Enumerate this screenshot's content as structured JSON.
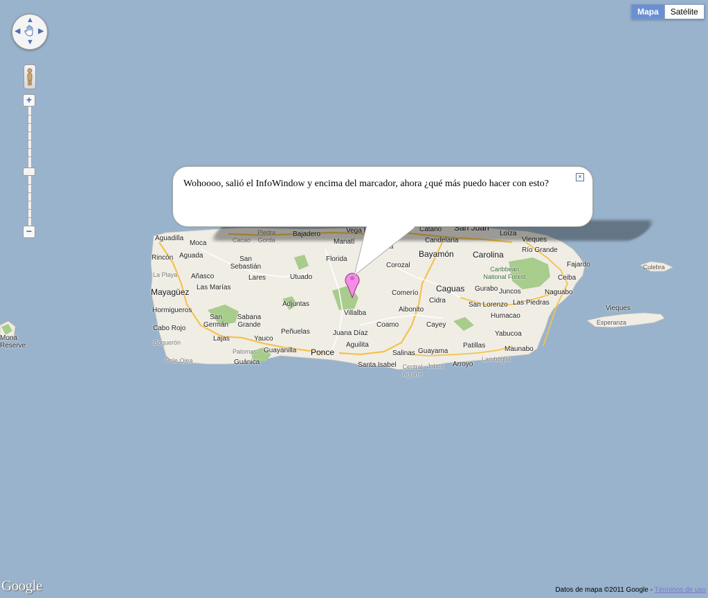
{
  "map_controls": {
    "map_type_buttons": [
      "Mapa",
      "Satélite"
    ],
    "active_map_type": "Mapa",
    "zoom_in": "+",
    "zoom_out": "−",
    "pan_arrows": [
      "▲",
      "◀",
      "▶",
      "▼"
    ]
  },
  "info_window": {
    "text": "Wohoooo, salió el InfoWindow y encima del marcador, ahora ¿qué más puedo hacer con esto?",
    "close": "×"
  },
  "marker": {
    "color": "#f58de6"
  },
  "place_labels": [
    "Aguadilla",
    "Moca",
    "Cacao",
    "Piedra Gorda",
    "Bajadero",
    "Vega Baja",
    "Manatí",
    "Vega Alta",
    "Cataño",
    "San Juan",
    "Loíza",
    "Vieques",
    "Candelaria",
    "Rincón",
    "Aguada",
    "San Sebastián",
    "Florida",
    "Corozal",
    "Bayamón",
    "Carolina",
    "Río Grande",
    "Fajardo",
    "Culebra",
    "La Playa",
    "Añasco",
    "Lares",
    "Utuado",
    "Caribbean National Forest",
    "Ceiba",
    "Mayagüez",
    "Las Marías",
    "Comerío",
    "Caguas",
    "Gurabo",
    "Juncos",
    "Naguabo",
    "Hormigueros",
    "Adjuntas",
    "Cidra",
    "San Lorenzo",
    "Las Piedras",
    "Aibonito",
    "Villalba",
    "Humacao",
    "Vieques",
    "Cabo Rojo",
    "San Germán",
    "Sabana Grande",
    "Coamo",
    "Cayey",
    "Esperanza",
    "Mona Reserve",
    "Peñuelas",
    "Juana Díaz",
    "Yabucoa",
    "Lajas",
    "Yauco",
    "Boquerón",
    "Palomas",
    "Guayanilla",
    "Ponce",
    "Aguilita",
    "Salinas",
    "Guayama",
    "Patillas",
    "Maunabo",
    "Pole Ojea",
    "Guánica",
    "Santa Isabel",
    "Central Aguirre",
    "Jobos",
    "Arroyo",
    "Lamboglia"
  ],
  "footer": {
    "logo": "Google",
    "attribution": "Datos de mapa ©2011 Google - ",
    "terms": "Términos de uso"
  },
  "colors": {
    "water": "#99b3cc",
    "land": "#f0ede5",
    "park": "#a8cc8c",
    "highway": "#f5c24a"
  }
}
